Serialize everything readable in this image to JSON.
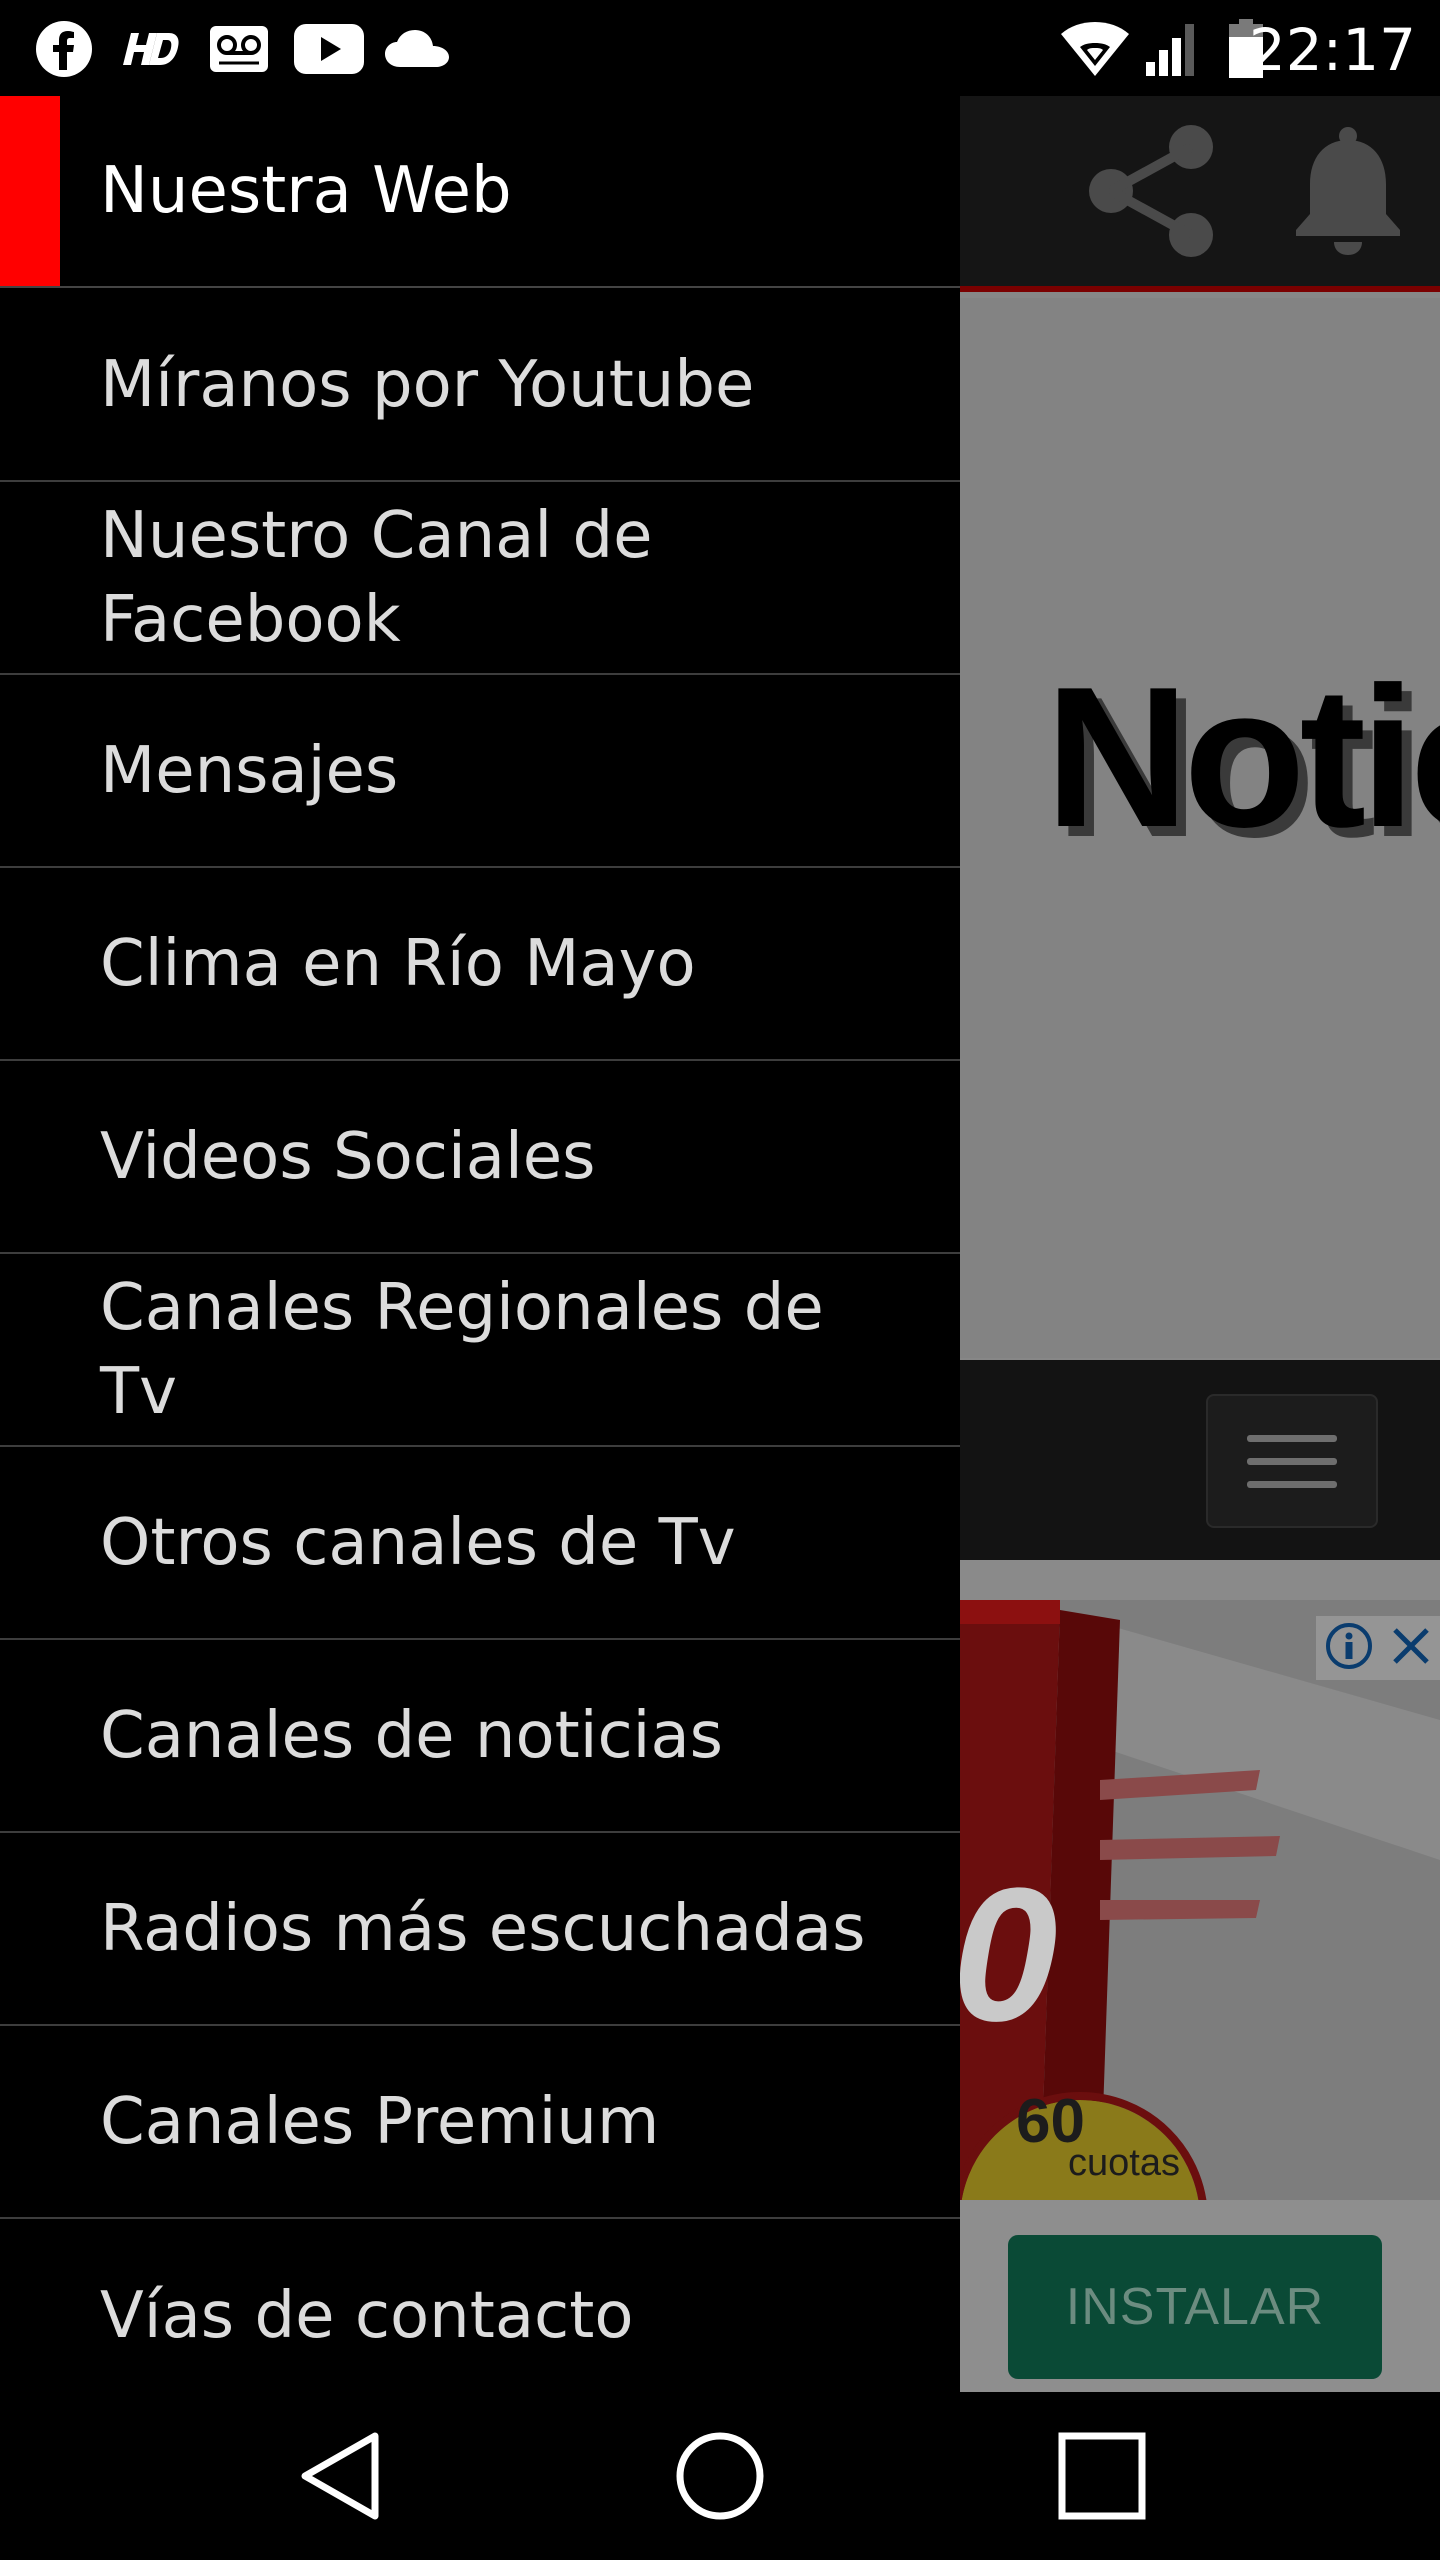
{
  "status_bar": {
    "time": "22:17",
    "left_icons": [
      "facebook-icon",
      "hd-icon",
      "voicemail-icon",
      "youtube-icon",
      "cloud-icon"
    ],
    "right_icons": [
      "wifi-icon",
      "signal-icon",
      "battery-icon"
    ]
  },
  "background_app": {
    "banner_title": "Notic",
    "ad": {
      "price_number": "60",
      "price_text": "cuotas",
      "install_label": "INSTALAR"
    }
  },
  "drawer": {
    "header_label": "Nuestra Web",
    "items": [
      {
        "label": "Míranos por Youtube"
      },
      {
        "label": "Nuestro Canal de Facebook"
      },
      {
        "label": "Mensajes"
      },
      {
        "label": "Clima en Río Mayo"
      },
      {
        "label": "Videos Sociales"
      },
      {
        "label": "Canales Regionales de Tv"
      },
      {
        "label": "Otros canales de Tv"
      },
      {
        "label": "Canales de noticias"
      },
      {
        "label": "Radios más escuchadas"
      },
      {
        "label": "Canales Premium"
      },
      {
        "label": "Vías de contacto"
      }
    ]
  },
  "colors": {
    "accent": "#ff0000",
    "drawer_background": "#000000",
    "install_button": "#0a4a36"
  }
}
